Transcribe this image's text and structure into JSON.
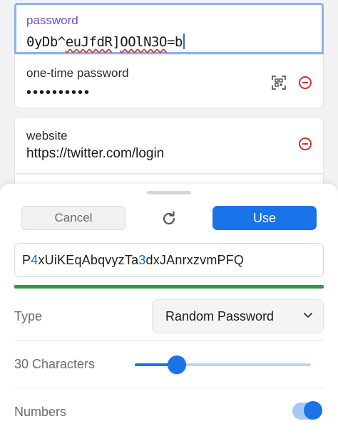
{
  "fields": {
    "password": {
      "label": "password",
      "value_pre": "0yDb^",
      "value_sq1": "euJfdR",
      "value_mid": "]",
      "value_sq2": "OOlN3O",
      "value_post": "=b"
    },
    "otp": {
      "label": "one-time password",
      "value": "••••••••••"
    },
    "website": {
      "label": "website",
      "value": "https://twitter.com/login"
    }
  },
  "generator": {
    "cancel_label": "Cancel",
    "use_label": "Use",
    "password_parts": [
      "P",
      "4",
      "xUiKEqAbqvyzTa",
      "3",
      "dxJAnrxzvmPFQ"
    ],
    "strength": 1.0,
    "type_label": "Type",
    "type_value": "Random Password",
    "length_label": "30 Characters",
    "length_slider_fraction": 0.24,
    "numbers_label": "Numbers",
    "numbers_enabled": true
  },
  "icons": {
    "refresh": "refresh-icon",
    "qr": "qr-scan-icon",
    "remove": "minus-circle-icon",
    "chevron": "chevron-down-icon"
  },
  "colors": {
    "accent": "#1a73e8",
    "strength_good": "#2e9c3a",
    "remove": "#c8362c",
    "label_active": "#6a52c9"
  }
}
